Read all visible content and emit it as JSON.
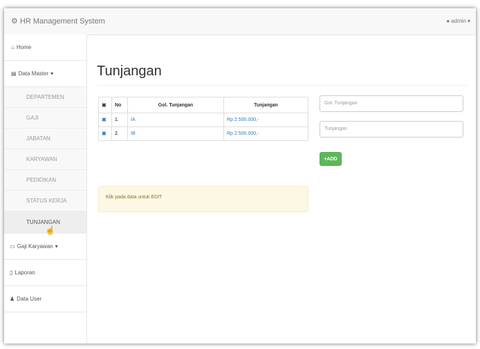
{
  "app": {
    "brand_icon": "gears-icon",
    "brand": "HR Management System",
    "user_icon": "user-icon",
    "user": "admin",
    "user_caret": "▾"
  },
  "sidebar": {
    "home": "Home",
    "data_master": "Data Master",
    "data_master_caret": "▾",
    "sub_items": [
      "DEPARTEMEN",
      "GAJI",
      "JABATAN",
      "KARYAWAN",
      "PEDIDIKAN",
      "STATUS KERJA",
      "TUNJANGAN"
    ],
    "active_sub": "TUNJANGAN",
    "gaji_karyawan": "Gaji Karyawan",
    "gaji_caret": "▾",
    "laporan": "Laporan",
    "data_user": "Data User"
  },
  "main": {
    "title": "Tunjangan",
    "table": {
      "headers": {
        "delete": "✖",
        "no": "No",
        "gol": "Gol. Tunjangan",
        "amount": "Tunjangan"
      },
      "rows": [
        {
          "no": "1.",
          "gol": "IA",
          "amount": "Rp 2.500.000,-"
        },
        {
          "no": "2.",
          "gol": "IB",
          "amount": "Rp 2.500.000,-"
        }
      ]
    },
    "alert": "Klik pada data untuk EDIT",
    "form": {
      "gol_placeholder": "Gol. Tunjangan",
      "amount_placeholder": "Tunjangan",
      "add_label": "+ADD"
    }
  },
  "colors": {
    "link": "#337ab7",
    "success": "#5cb85c",
    "alert_bg": "#fcf8e3"
  }
}
